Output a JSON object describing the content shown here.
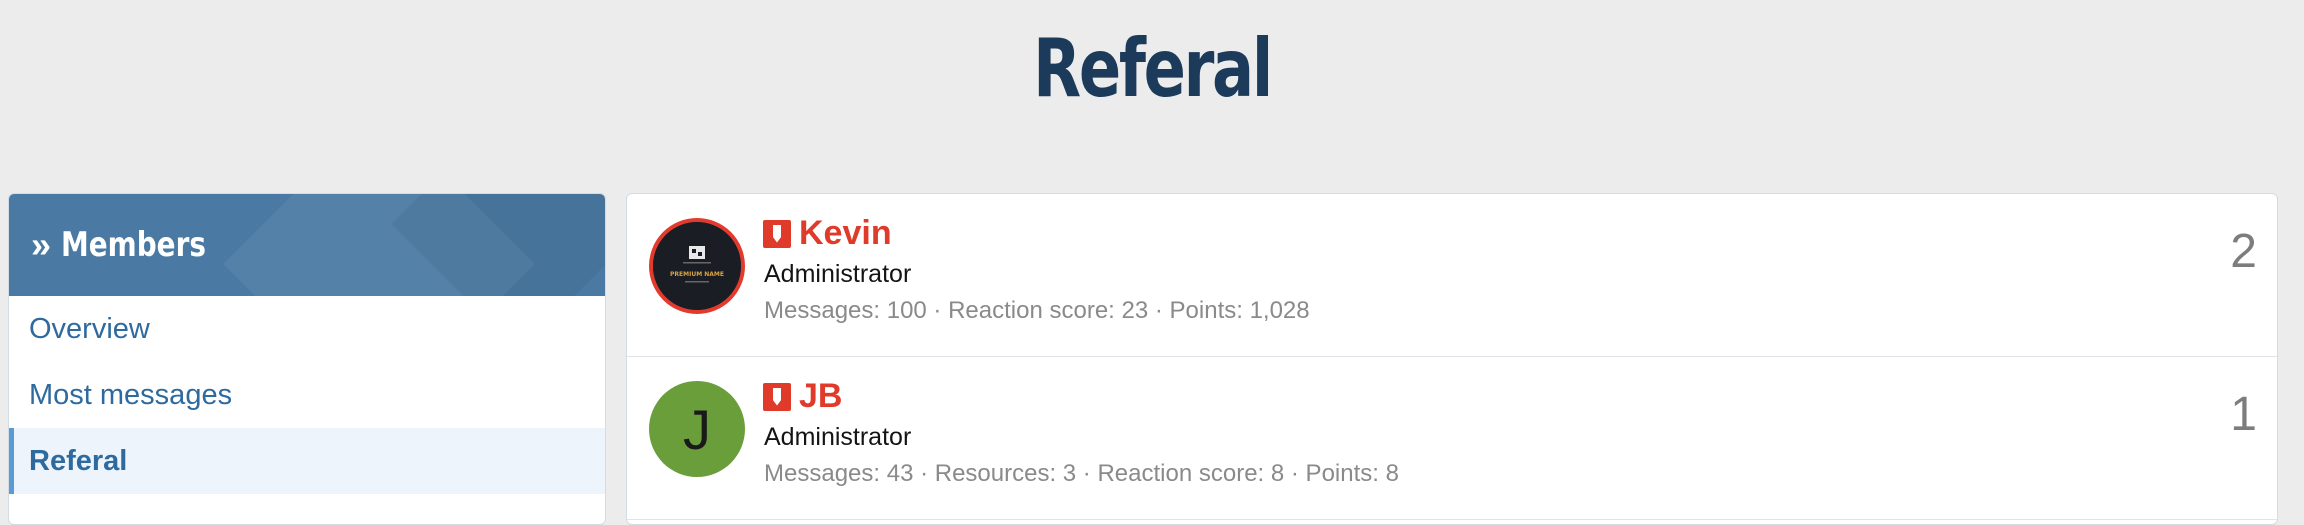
{
  "page": {
    "title": "Referal"
  },
  "sidebar": {
    "header": "Members",
    "items": [
      {
        "label": "Overview",
        "selected": false
      },
      {
        "label": "Most messages",
        "selected": false
      },
      {
        "label": "Referal",
        "selected": true
      }
    ]
  },
  "members": [
    {
      "name": "Kevin",
      "role": "Administrator",
      "stats": "Messages: 100 · Reaction score: 23 · Points: 1,028",
      "count": "2",
      "avatar_text": "PREMIUM NAME"
    },
    {
      "name": "JB",
      "role": "Administrator",
      "stats": "Messages: 43 · Resources: 3 · Reaction score: 8 · Points: 8",
      "count": "1",
      "avatar_letter": "J"
    }
  ],
  "colors": {
    "accent": "#4a7aa3",
    "title": "#1c3a5a",
    "username": "#e03a2a",
    "link": "#2f6a9f",
    "avatar_green": "#6a9e3a"
  }
}
